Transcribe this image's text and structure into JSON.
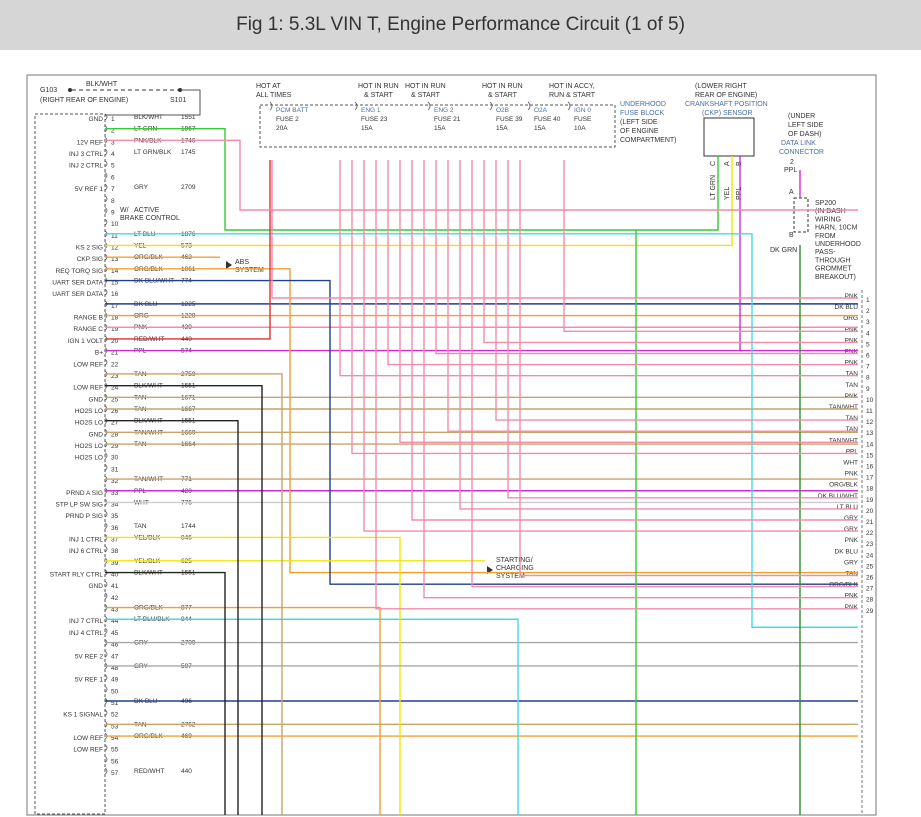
{
  "title": "Fig 1: 5.3L VIN T, Engine Performance Circuit (1 of 5)",
  "ground_ref": {
    "name": "G103",
    "desc": "(RIGHT REAR OF ENGINE)",
    "wire": "BLK/WHT",
    "splice": "S101"
  },
  "pcm_pins": [
    {
      "n": "1",
      "label": "GND",
      "color": "BLK/WHT",
      "circuit": "1551"
    },
    {
      "n": "2",
      "label": "",
      "color": "LT GRN",
      "circuit": "1867"
    },
    {
      "n": "3",
      "label": "12V REF",
      "color": "PNK/BLK",
      "circuit": "1746"
    },
    {
      "n": "4",
      "label": "INJ 3 CTRL",
      "color": "LT GRN/BLK",
      "circuit": "1745"
    },
    {
      "n": "5",
      "label": "INJ 2 CTRL",
      "color": "",
      "circuit": ""
    },
    {
      "n": "6",
      "label": "",
      "color": "",
      "circuit": ""
    },
    {
      "n": "7",
      "label": "5V REF 1",
      "color": "GRY",
      "circuit": "2709"
    },
    {
      "n": "8",
      "label": "",
      "color": "",
      "circuit": ""
    },
    {
      "n": "9",
      "label": "",
      "color": "",
      "circuit": ""
    },
    {
      "n": "10",
      "label": "",
      "color": "",
      "circuit": ""
    },
    {
      "n": "11",
      "label": "",
      "color": "LT BLU",
      "circuit": "1876"
    },
    {
      "n": "12",
      "label": "KS 2 SIG",
      "color": "YEL",
      "circuit": "573"
    },
    {
      "n": "13",
      "label": "CKP SIG",
      "color": "ORG/BLK",
      "circuit": "463"
    },
    {
      "n": "14",
      "label": "REQ TORQ SIG",
      "color": "ORG/BLK",
      "circuit": "1061"
    },
    {
      "n": "15",
      "label": "UART SER DATA",
      "color": "DK BLU/WHT",
      "circuit": "774"
    },
    {
      "n": "16",
      "label": "UART SER DATA",
      "color": "",
      "circuit": ""
    },
    {
      "n": "17",
      "label": "",
      "color": "DK BLU",
      "circuit": "1225"
    },
    {
      "n": "18",
      "label": "RANGE B",
      "color": "ORG",
      "circuit": "1228"
    },
    {
      "n": "19",
      "label": "RANGE C",
      "color": "PNK",
      "circuit": "439"
    },
    {
      "n": "20",
      "label": "IGN 1 VOLT",
      "color": "RED/WHT",
      "circuit": "440"
    },
    {
      "n": "21",
      "label": "B+",
      "color": "PPL",
      "circuit": "574"
    },
    {
      "n": "22",
      "label": "LOW REF",
      "color": "",
      "circuit": ""
    },
    {
      "n": "23",
      "label": "",
      "color": "TAN",
      "circuit": "2759"
    },
    {
      "n": "24",
      "label": "LOW REF",
      "color": "BLK/WHT",
      "circuit": "1551"
    },
    {
      "n": "25",
      "label": "GND",
      "color": "TAN",
      "circuit": "1671"
    },
    {
      "n": "26",
      "label": "HO2S LO",
      "color": "TAN",
      "circuit": "1667"
    },
    {
      "n": "27",
      "label": "HO2S LO",
      "color": "BLK/WHT",
      "circuit": "1551"
    },
    {
      "n": "28",
      "label": "GND",
      "color": "TAN/WHT",
      "circuit": "1669"
    },
    {
      "n": "29",
      "label": "HO2S LO",
      "color": "TAN",
      "circuit": "1664"
    },
    {
      "n": "30",
      "label": "HO2S LO",
      "color": "",
      "circuit": ""
    },
    {
      "n": "31",
      "label": "",
      "color": "",
      "circuit": ""
    },
    {
      "n": "32",
      "label": "",
      "color": "TAN/WHT",
      "circuit": "771"
    },
    {
      "n": "33",
      "label": "PRND A SIG",
      "color": "PPL",
      "circuit": "420"
    },
    {
      "n": "34",
      "label": "STP LP SW SIG",
      "color": "WHT",
      "circuit": "776"
    },
    {
      "n": "35",
      "label": "PRND P SIG",
      "color": "",
      "circuit": ""
    },
    {
      "n": "36",
      "label": "",
      "color": "TAN",
      "circuit": "1744"
    },
    {
      "n": "37",
      "label": "INJ 1 CTRL",
      "color": "YEL/BLK",
      "circuit": "846"
    },
    {
      "n": "38",
      "label": "INJ 6 CTRL",
      "color": "",
      "circuit": ""
    },
    {
      "n": "39",
      "label": "",
      "color": "YEL/BLK",
      "circuit": "625"
    },
    {
      "n": "40",
      "label": "START RLY CTRL",
      "color": "BLK/WHT",
      "circuit": "1551"
    },
    {
      "n": "41",
      "label": "GND",
      "color": "",
      "circuit": ""
    },
    {
      "n": "42",
      "label": "",
      "color": "",
      "circuit": ""
    },
    {
      "n": "43",
      "label": "",
      "color": "ORG/BLK",
      "circuit": "877"
    },
    {
      "n": "44",
      "label": "INJ 7 CTRL",
      "color": "LT BLU/BLK",
      "circuit": "844"
    },
    {
      "n": "45",
      "label": "INJ 4 CTRL",
      "color": "",
      "circuit": ""
    },
    {
      "n": "46",
      "label": "",
      "color": "GRY",
      "circuit": "2709"
    },
    {
      "n": "47",
      "label": "5V REF 2",
      "color": "",
      "circuit": ""
    },
    {
      "n": "48",
      "label": "",
      "color": "GRY",
      "circuit": "597"
    },
    {
      "n": "49",
      "label": "5V REF 1",
      "color": "",
      "circuit": ""
    },
    {
      "n": "50",
      "label": "",
      "color": "",
      "circuit": ""
    },
    {
      "n": "51",
      "label": "",
      "color": "DK BLU",
      "circuit": "496"
    },
    {
      "n": "52",
      "label": "KS 1 SIGNAL",
      "color": "",
      "circuit": ""
    },
    {
      "n": "53",
      "label": "",
      "color": "TAN",
      "circuit": "2762"
    },
    {
      "n": "54",
      "label": "LOW REF",
      "color": "ORG/BLK",
      "circuit": "469"
    },
    {
      "n": "55",
      "label": "LOW REF",
      "color": "",
      "circuit": ""
    },
    {
      "n": "56",
      "label": "",
      "color": "",
      "circuit": ""
    },
    {
      "n": "57",
      "label": "",
      "color": "RED/WHT",
      "circuit": "440"
    }
  ],
  "fuses": [
    {
      "header": "HOT AT ALL TIMES",
      "name": "PCM BATT",
      "fuse": "FUSE 2",
      "amps": "20A"
    },
    {
      "header": "HOT IN RUN & START",
      "name": "ENG 1",
      "fuse": "FUSE 23",
      "amps": "15A"
    },
    {
      "header": "HOT IN RUN & START",
      "name": "ENG 2",
      "fuse": "FUSE 21",
      "amps": "15A"
    },
    {
      "header": "HOT IN RUN & START",
      "name": "O2B",
      "fuse": "FUSE 39",
      "amps": "15A"
    },
    {
      "header": "",
      "name": "O2A",
      "fuse": "FUSE 40",
      "amps": "15A"
    },
    {
      "header": "HOT IN ACCY, RUN & START",
      "name": "IGN 0",
      "fuse": "FUSE",
      "amps": "10A"
    }
  ],
  "fuse_block_label": [
    "UNDERHOOD",
    "FUSE BLOCK",
    "(LEFT SIDE",
    "OF ENGINE",
    "COMPARTMENT)"
  ],
  "ckp": {
    "loc": [
      "(LOWER RIGHT",
      "REAR OF ENGINE)"
    ],
    "name": "CRANKSHAFT POSITION",
    "short": "(CKP) SENSOR",
    "pins": [
      "C",
      "A",
      "B"
    ],
    "wires": [
      "LT GRN",
      "YEL",
      "PPL"
    ]
  },
  "dlc": {
    "loc": [
      "(UNDER",
      "LEFT SIDE",
      "OF DASH)"
    ],
    "name": "DATA LINK",
    "name2": "CONNECTOR",
    "pin": "2",
    "wire": "PPL"
  },
  "sp200": {
    "lines": [
      "SP200",
      "(IN DASH",
      "WIRING",
      "HARN, 10CM",
      "FROM",
      "UNDERHOOD",
      "PASS-",
      "THROUGH",
      "GROMMET",
      "BREAKOUT)"
    ],
    "wire": "DK GRN",
    "pins": [
      "A",
      "B"
    ]
  },
  "annotations": {
    "brake": "W/ ACTIVE BRAKE CONTROL",
    "abs": "ABS SYSTEM",
    "starting": [
      "STARTING/",
      "CHARGING",
      "SYSTEM"
    ]
  },
  "right_connector": [
    {
      "n": "1",
      "wire": "PNK"
    },
    {
      "n": "2",
      "wire": "DK BLU"
    },
    {
      "n": "3",
      "wire": "ORG"
    },
    {
      "n": "4",
      "wire": "PNK"
    },
    {
      "n": "5",
      "wire": "PNK"
    },
    {
      "n": "6",
      "wire": "PNK"
    },
    {
      "n": "7",
      "wire": "PNK"
    },
    {
      "n": "8",
      "wire": "TAN"
    },
    {
      "n": "9",
      "wire": "TAN"
    },
    {
      "n": "10",
      "wire": "PNK"
    },
    {
      "n": "11",
      "wire": "TAN/WHT"
    },
    {
      "n": "12",
      "wire": "TAN"
    },
    {
      "n": "13",
      "wire": "TAN"
    },
    {
      "n": "14",
      "wire": "TAN/WHT"
    },
    {
      "n": "15",
      "wire": "PPL"
    },
    {
      "n": "16",
      "wire": "WHT"
    },
    {
      "n": "17",
      "wire": "PNK"
    },
    {
      "n": "18",
      "wire": "ORG/BLK"
    },
    {
      "n": "19",
      "wire": "DK BLU/WHT"
    },
    {
      "n": "20",
      "wire": "LT BLU"
    },
    {
      "n": "21",
      "wire": "GRY"
    },
    {
      "n": "22",
      "wire": "GRY"
    },
    {
      "n": "23",
      "wire": "PNK"
    },
    {
      "n": "24",
      "wire": "DK BLU"
    },
    {
      "n": "25",
      "wire": "GRY"
    },
    {
      "n": "26",
      "wire": "TAN"
    },
    {
      "n": "27",
      "wire": "ORG/BLK"
    },
    {
      "n": "28",
      "wire": "PNK"
    },
    {
      "n": "29",
      "wire": "PNK"
    }
  ],
  "wire_colors": {
    "PNK": "#f28ca8",
    "ORG": "#f0a030",
    "TAN": "#c9a46a",
    "DK BLU": "#1f3f8f",
    "LT BLU": "#44d9e8",
    "GRY": "#a8a8a8",
    "PPL": "#d22ad2",
    "YEL": "#f2e600",
    "LT GRN": "#33cc33",
    "BLK": "#222222",
    "RED": "#e03030",
    "WHT": "#cccccc",
    "DK GRN": "#2f8f2f"
  }
}
